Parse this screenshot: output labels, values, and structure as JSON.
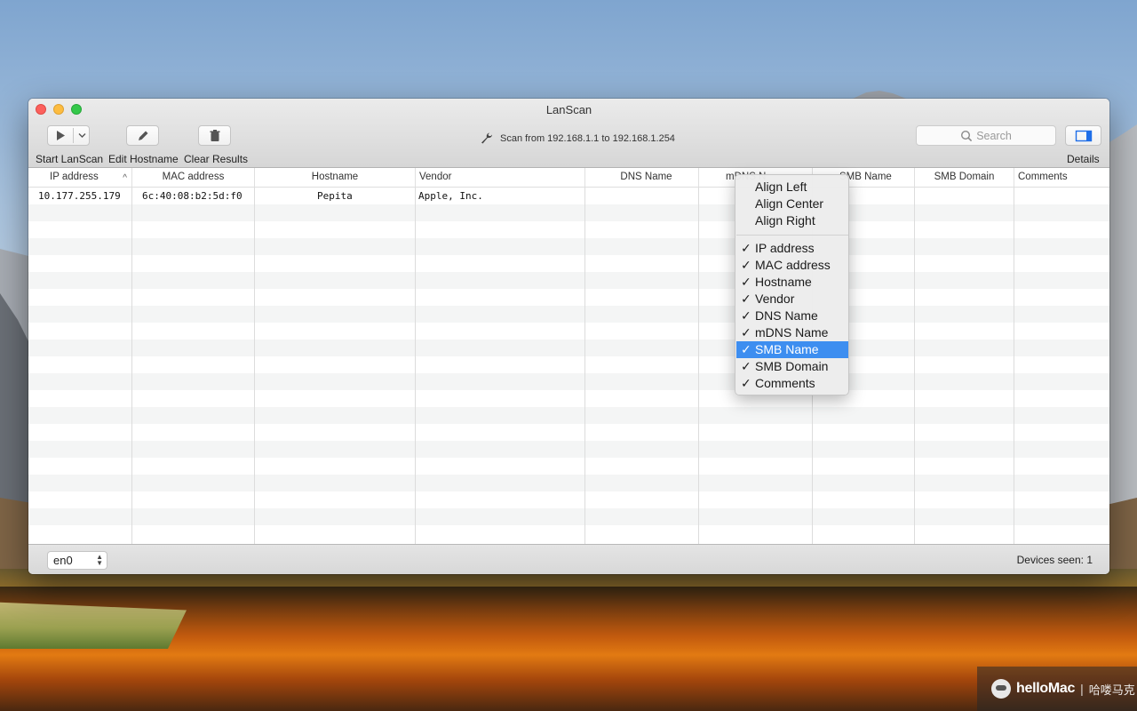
{
  "window": {
    "title": "LanScan"
  },
  "toolbar": {
    "start_label": "Start LanScan",
    "edit_label": "Edit Hostname",
    "clear_label": "Clear Results",
    "details_label": "Details",
    "scan_range": "Scan from 192.168.1.1 to 192.168.1.254",
    "search_placeholder": "Search"
  },
  "table": {
    "columns": [
      "IP address",
      "MAC address",
      "Hostname",
      "Vendor",
      "DNS Name",
      "mDNS N",
      "SMB Name",
      "SMB Domain",
      "Comments"
    ],
    "sort_indicator": "^",
    "rows": [
      {
        "ip": "10.177.255.179",
        "mac": "6c:40:08:b2:5d:f0",
        "hostname": "Pepita",
        "vendor": "Apple, Inc.",
        "dns": "",
        "mdns": "",
        "smb_name": "",
        "smb_domain": "",
        "comments": ""
      }
    ]
  },
  "bottom": {
    "interface": "en0",
    "devices_seen": "Devices seen: 1"
  },
  "context_menu": {
    "align_items": [
      "Align Left",
      "Align Center",
      "Align Right"
    ],
    "column_items": [
      {
        "label": "IP address",
        "checked": true
      },
      {
        "label": "MAC address",
        "checked": true
      },
      {
        "label": "Hostname",
        "checked": true
      },
      {
        "label": "Vendor",
        "checked": true
      },
      {
        "label": "DNS Name",
        "checked": true
      },
      {
        "label": "mDNS Name",
        "checked": true
      },
      {
        "label": "SMB Name",
        "checked": true,
        "highlighted": true
      },
      {
        "label": "SMB Domain",
        "checked": true
      },
      {
        "label": "Comments",
        "checked": true
      }
    ],
    "check_glyph": "✓"
  },
  "watermark": {
    "brand": "helloMac",
    "separator": "|",
    "cn": "哈喽马克"
  },
  "colors": {
    "menu_highlight": "#3d8ef0",
    "close": "#fc605c",
    "minimize": "#fdbc40",
    "maximize": "#34c84a"
  }
}
